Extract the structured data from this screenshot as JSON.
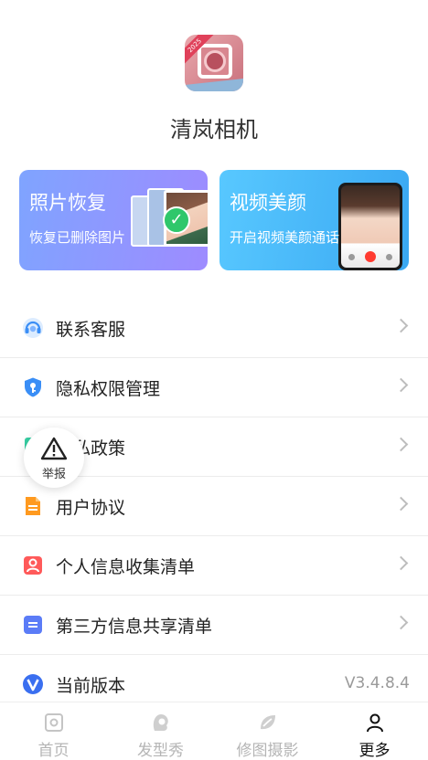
{
  "app": {
    "name": "清岚相机",
    "icon_badge": "2025"
  },
  "cards": [
    {
      "title": "照片恢复",
      "subtitle": "恢复已删除图片",
      "color": "#8a98ff"
    },
    {
      "title": "视频美颜",
      "subtitle": "开启视频美颜通话",
      "color": "#4fb8fb"
    }
  ],
  "menu": {
    "items": [
      {
        "label": "联系客服",
        "icon": "headset-icon"
      },
      {
        "label": "隐私权限管理",
        "icon": "shield-key-icon"
      },
      {
        "label": "隐私政策",
        "icon": "policy-icon"
      },
      {
        "label": "用户协议",
        "icon": "document-icon"
      },
      {
        "label": "个人信息收集清单",
        "icon": "person-list-icon"
      },
      {
        "label": "第三方信息共享清单",
        "icon": "share-list-icon"
      },
      {
        "label": "当前版本",
        "icon": "version-v-icon",
        "value": "V3.4.8.4"
      }
    ]
  },
  "report": {
    "label": "举报",
    "icon": "warning-triangle-icon"
  },
  "tabbar": {
    "tabs": [
      {
        "label": "首页",
        "icon": "home-icon",
        "active": false
      },
      {
        "label": "发型秀",
        "icon": "hairstyle-icon",
        "active": false
      },
      {
        "label": "修图摄影",
        "icon": "retouch-icon",
        "active": false
      },
      {
        "label": "更多",
        "icon": "person-icon",
        "active": true
      }
    ]
  },
  "colors": {
    "accent_blue": "#3a8ef6",
    "inactive_tab": "#b5b5b5",
    "active_tab": "#111111"
  }
}
